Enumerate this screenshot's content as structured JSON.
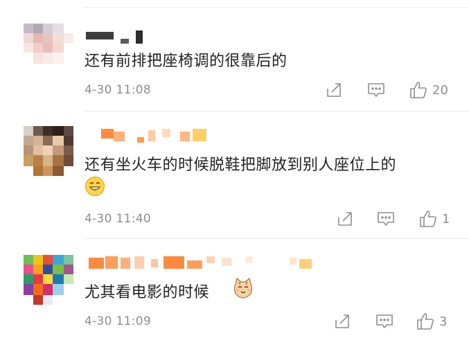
{
  "comments": [
    {
      "text": "还有前排把座椅调的很靠后的",
      "time": "4-30 11:08",
      "likes": "20",
      "emoji": "",
      "actions": {
        "forward": "share-icon",
        "comment": "comment-icon",
        "like": "thumbs-up-icon"
      }
    },
    {
      "text": "还有坐火车的时候脱鞋把脚放到别人座位上的",
      "time": "4-30 11:40",
      "likes": "1",
      "emoji": "grinning-emoji",
      "actions": {
        "forward": "share-icon",
        "comment": "comment-icon",
        "like": "thumbs-up-icon"
      }
    },
    {
      "text": "尤其看电影的时候",
      "time": "4-30 11:09",
      "likes": "3",
      "emoji": "cat-emoji",
      "actions": {
        "forward": "share-icon",
        "comment": "comment-icon",
        "like": "thumbs-up-icon"
      }
    }
  ],
  "colors": {
    "text": "#222222",
    "meta": "#8e8e8e",
    "divider": "#ededed"
  }
}
